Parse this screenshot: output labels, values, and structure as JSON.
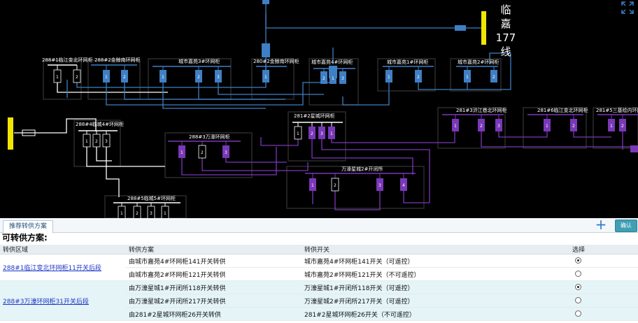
{
  "diagram": {
    "line_label": [
      "临",
      "嘉",
      "177",
      "线"
    ],
    "cabinets": [
      {
        "name": "288#1临江变北环网柜",
        "switches": [
          "1",
          "2"
        ]
      },
      {
        "name": "288#2金鲸南环网柜",
        "switches": [
          "1",
          "2"
        ]
      },
      {
        "name": "城市嘉苑3#环网柜",
        "switches": [
          "1",
          "2",
          "3"
        ]
      },
      {
        "name": "280#2金鲸南环网柜",
        "switches": [
          "1"
        ]
      },
      {
        "name": "城市嘉苑4#环网柜",
        "switches": [
          "1",
          "2",
          "3"
        ]
      },
      {
        "name": "城市嘉苑1#环网柜",
        "switches": [
          "1",
          "2"
        ]
      },
      {
        "name": "城市嘉苑2#环网柜",
        "switches": [
          "1",
          "2"
        ]
      },
      {
        "name": "288#4临城4#环网柜",
        "switches": [
          "1",
          "2",
          "3"
        ]
      },
      {
        "name": "281#2星城环网柜",
        "switches": [
          "1",
          "2",
          "3"
        ]
      },
      {
        "name": "281#3浒江巷北环网柜",
        "switches": [
          "1",
          "2",
          "3"
        ]
      },
      {
        "name": "281#6临江变北环网柜",
        "switches": [
          "1",
          "2"
        ]
      },
      {
        "name": "281#5三基绘内环网柜",
        "switches": [
          "1",
          "2"
        ]
      },
      {
        "name": "288#3万濠环网柜",
        "switches": [
          "1",
          "2",
          "3"
        ]
      },
      {
        "name": "万濠星城2#开闭所",
        "switches": [
          "1",
          "2",
          "3",
          "4"
        ]
      },
      {
        "name": "288#5临城5#环网柜",
        "switches": [
          "1",
          "2",
          "3"
        ]
      }
    ],
    "colors": {
      "blue": "#3f7fc4",
      "purple": "#7a38b8",
      "white": "#ffffff",
      "yellow": "#f2e600"
    }
  },
  "panel": {
    "tab_label": "推荐转供方案",
    "confirm_label": "确认",
    "heading": "可转供方案:",
    "columns": [
      "转供区域",
      "转供方案",
      "转供开关",
      "选择"
    ],
    "groups": [
      {
        "area": "288#1临江变北环网柜11开关后段",
        "rows": [
          {
            "plan": "由城市嘉苑4#环网柜141开关转供",
            "switch": "城市嘉苑4#环网柜141开关（可遥控）",
            "selected": true
          },
          {
            "plan": "由城市嘉苑2#环网柜121开关转供",
            "switch": "城市嘉苑2#环网柜121开关（不可遥控）",
            "selected": false
          }
        ]
      },
      {
        "area": "288#3万濠环网柜31开关后段",
        "rows": [
          {
            "plan": "由万濠星城1#开闭所118开关转供",
            "switch": "万濠星城1#开闭所118开关（可遥控）",
            "selected": true
          },
          {
            "plan": "由万濠星城2#开闭所217开关转供",
            "switch": "万濠星城2#开闭所217开关（可遥控）",
            "selected": false
          },
          {
            "plan": "由281#2星城环网柜26开关转供",
            "switch": "281#2星城环网柜26开关（不可遥控）",
            "selected": false
          }
        ]
      }
    ]
  }
}
